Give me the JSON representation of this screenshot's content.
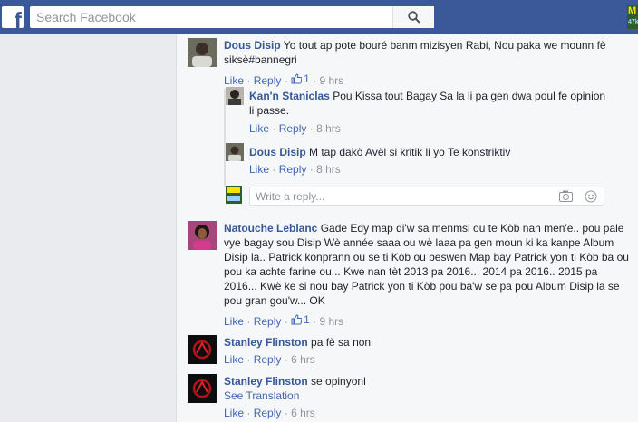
{
  "header": {
    "logo": "f",
    "search_placeholder": "Search Facebook",
    "corner_thumb_top": "M",
    "corner_thumb_bottom": "47k"
  },
  "actions_labels": {
    "like": "Like",
    "reply": "Reply",
    "separator": "·"
  },
  "comments": [
    {
      "author": "Dous Disip",
      "text": "Yo tout ap pote bouré banm mizisyen Rabi, Nou paka we mounn fè siksè#bannegri",
      "likes": "1",
      "time": "9 hrs",
      "replies": [
        {
          "author": "Kan'n Staniclas",
          "text": "Pou Kissa tout Bagay Sa la li pa gen dwa poul fe opinion li passe.",
          "time": "8 hrs"
        },
        {
          "author": "Dous Disip",
          "text": "M tap dakò Avèl si kritik li yo Te konstriktiv",
          "time": "8 hrs"
        }
      ],
      "reply_placeholder": "Write a reply..."
    },
    {
      "author": "Natouche Leblanc",
      "text": "Gade Edy map di'w sa menmsi ou te Kòb nan men'e.. pou pale vye bagay sou Disip Wè année saaa ou wè laaa pa gen moun ki ka kanpe Album Disip la.. Patrick konprann ou se ti Kòb ou beswen Map bay Patrick yon ti Kòb ba ou pou ka achte farine ou... Kwe nan tèt 2013 pa 2016... 2014 pa 2016.. 2015 pa 2016... Kwè ke si nou bay Patrick yon ti Kòb pou ba'w se pa pou Album Disip la se pou gran gou'w... OK",
      "likes": "1",
      "time": "9 hrs"
    },
    {
      "author": "Stanley Flinston",
      "text": "pa fè sa non",
      "time": "6 hrs"
    },
    {
      "author": "Stanley Flinston",
      "text": "se opinyonl",
      "see_translation": "See Translation",
      "time": "6 hrs"
    }
  ],
  "colors": {
    "header_bg": "#3b5998",
    "link_blue": "#365899",
    "action_blue": "#4267b2",
    "meta_gray": "#90949c"
  }
}
